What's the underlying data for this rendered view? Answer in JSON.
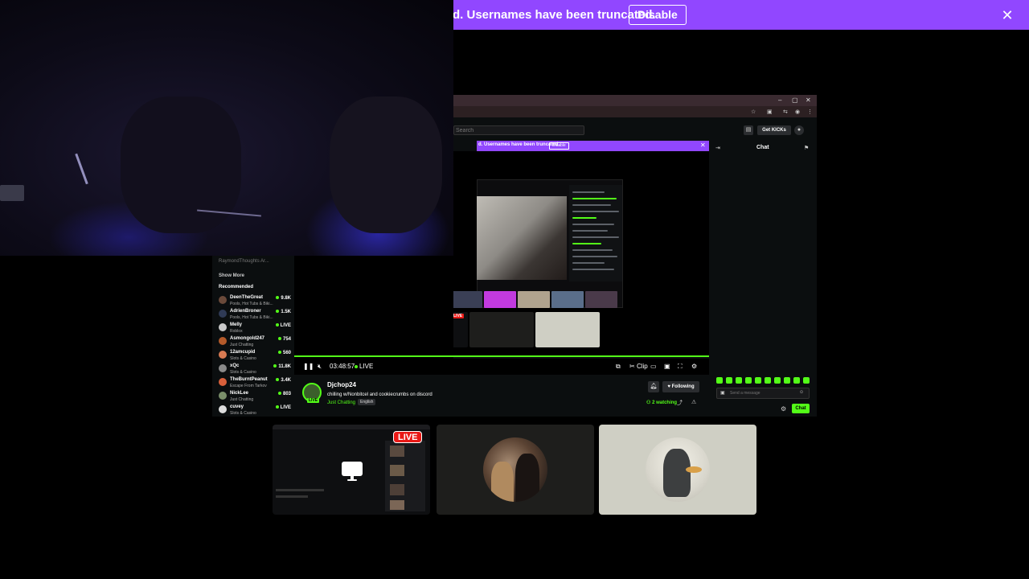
{
  "banner": {
    "text": "d. Usernames have been truncated.",
    "button_label": "Disable",
    "close_icon": "close-icon"
  },
  "inner_browser": {
    "search_placeholder": "Search",
    "get_kicks_label": "Get KICKs",
    "inner_banner_text": "d. Usernames have been truncated.",
    "inner_banner_button": "Disable"
  },
  "sidebar": {
    "top_item": "RaymondThoughts Ar...",
    "show_more": "Show More",
    "recommended_title": "Recommended",
    "items": [
      {
        "name": "DeenTheGreat",
        "category": "Pools, Hot Tubs & Biki...",
        "count": "9.8K",
        "color": "#6b4a3a"
      },
      {
        "name": "AdrienBroner",
        "category": "Pools, Hot Tubs & Biki...",
        "count": "1.5K",
        "color": "#2f3a55"
      },
      {
        "name": "Melly",
        "category": "Roblox",
        "count": "LIVE",
        "color": "#c9c9c9"
      },
      {
        "name": "Asmongold247",
        "category": "Just Chatting",
        "count": "754",
        "color": "#b45a2a"
      },
      {
        "name": "12amcupid",
        "category": "Slots & Casino",
        "count": "560",
        "color": "#d87a52"
      },
      {
        "name": "xQc",
        "category": "Slots & Casino",
        "count": "11.8K",
        "color": "#8a8a8a"
      },
      {
        "name": "TheBurntPeanut",
        "category": "Escape From Tarkov",
        "count": "3.4K",
        "color": "#d9603b"
      },
      {
        "name": "NickLee",
        "category": "Just Chatting",
        "count": "803",
        "color": "#7a8f6a"
      },
      {
        "name": "cuvey",
        "category": "Slots & Casino",
        "count": "LIVE",
        "color": "#dddddd"
      }
    ]
  },
  "player": {
    "time": "03:48:57",
    "live_label": "LIVE",
    "clip_label": "Clip"
  },
  "channel": {
    "name": "Djchop24",
    "live_badge": "LIVE",
    "title": "chilling w/Nonbitcel and cookiecrumbs on discord",
    "category": "Just Chatting",
    "language": "English",
    "follow_label": "Following",
    "watching": "2 watching"
  },
  "chat": {
    "title": "Chat",
    "placeholder": "Send a message",
    "send_label": "Chat"
  },
  "bottom_thumbs": {
    "live_badge": "LIVE"
  },
  "colors": {
    "kick_green": "#53fc18",
    "twitch_purple": "#9147ff",
    "live_red": "#e91916"
  }
}
